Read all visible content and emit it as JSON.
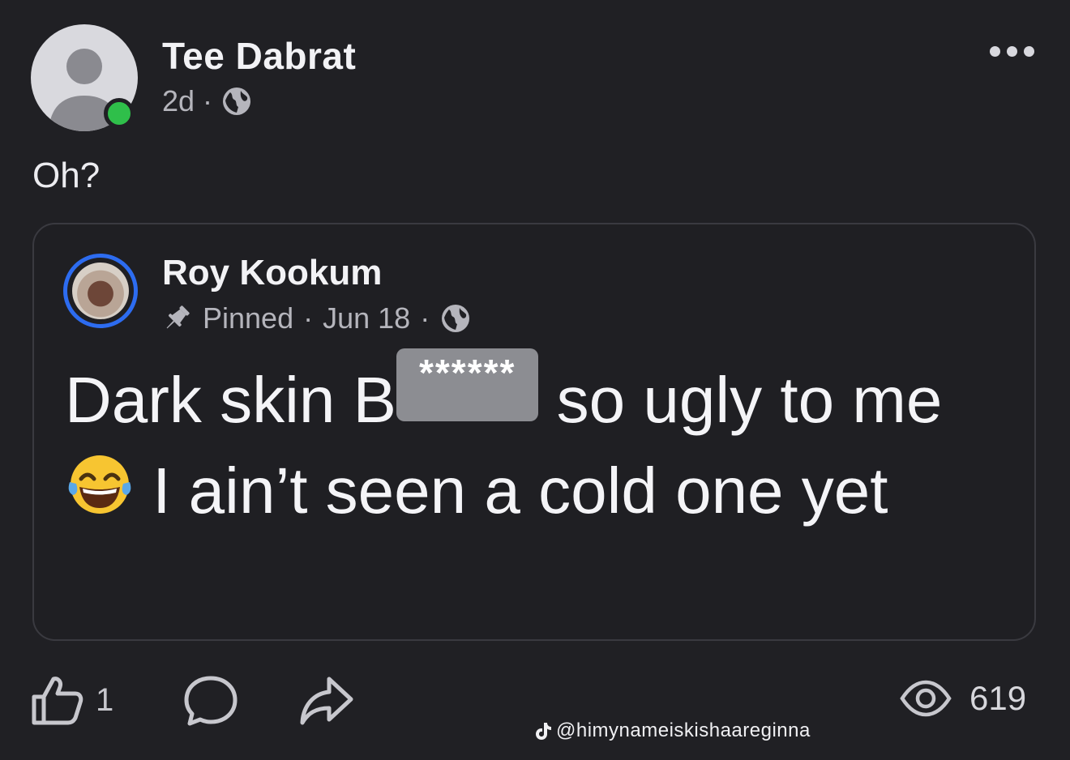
{
  "post": {
    "author": "Tee Dabrat",
    "time": "2d",
    "separator": "·",
    "text": "Oh?"
  },
  "quoted_post": {
    "author": "Roy Kookum",
    "pinned_label": "Pinned",
    "date": "Jun 18",
    "separator": "·",
    "text_part1": "Dark skin B",
    "censor": "******",
    "text_part2": " so ugly to me",
    "text_part3": " I ain’t seen a cold one yet",
    "emoji": "face-with-tears-of-joy"
  },
  "actions": {
    "like_count": "1",
    "view_count": "619"
  },
  "watermark": "@himynameiskishaareginna",
  "colors": {
    "background": "#202024",
    "online": "#2fbf4a",
    "story_ring": "#2d6cf0",
    "censor_bg": "#8c8d92"
  },
  "icons": [
    "more-icon",
    "globe-icon",
    "pin-icon",
    "like-icon",
    "comment-icon",
    "share-icon",
    "eye-icon",
    "tiktok-icon"
  ]
}
